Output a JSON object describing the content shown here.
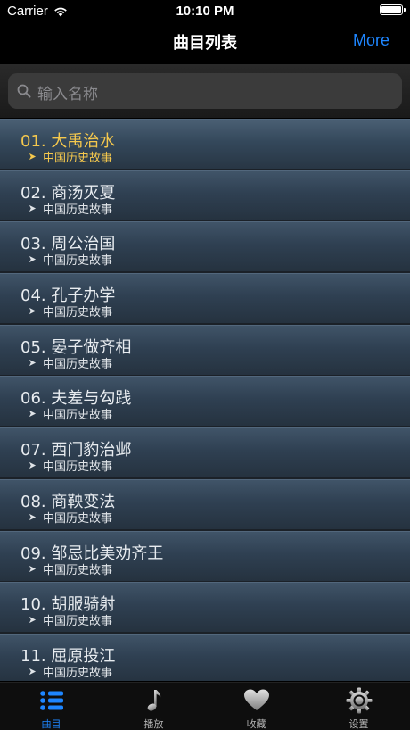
{
  "status_bar": {
    "carrier": "Carrier",
    "time": "10:10 PM"
  },
  "nav": {
    "title": "曲目列表",
    "more_label": "More"
  },
  "search": {
    "placeholder": "输入名称"
  },
  "colors": {
    "accent": "#1e86ff",
    "selected_text": "#f5c84d",
    "row_text": "#e8ecf0"
  },
  "tracks": [
    {
      "title": "01. 大禹治水",
      "category": "中国历史故事",
      "selected": true
    },
    {
      "title": "02. 商汤灭夏",
      "category": "中国历史故事"
    },
    {
      "title": "03. 周公治国",
      "category": "中国历史故事"
    },
    {
      "title": "04. 孔子办学",
      "category": "中国历史故事"
    },
    {
      "title": "05. 晏子做齐相",
      "category": "中国历史故事"
    },
    {
      "title": "06. 夫差与勾践",
      "category": "中国历史故事"
    },
    {
      "title": "07. 西门豹治邺",
      "category": "中国历史故事"
    },
    {
      "title": "08. 商鞅变法",
      "category": "中国历史故事"
    },
    {
      "title": "09. 邹忌比美劝齐王",
      "category": "中国历史故事"
    },
    {
      "title": "10. 胡服骑射",
      "category": "中国历史故事"
    },
    {
      "title": "11. 屈原投江",
      "category": "中国历史故事"
    }
  ],
  "tabs": [
    {
      "label": "曲目",
      "icon": "list-icon",
      "active": true
    },
    {
      "label": "播放",
      "icon": "music-note-icon"
    },
    {
      "label": "收藏",
      "icon": "heart-icon"
    },
    {
      "label": "设置",
      "icon": "gear-icon"
    }
  ]
}
